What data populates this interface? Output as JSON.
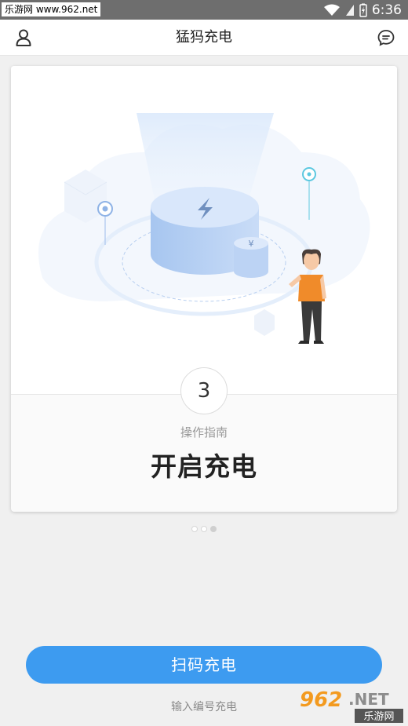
{
  "status_bar": {
    "watermark": "乐游网 www.962.net",
    "time": "6:36",
    "icons": [
      "wifi-icon",
      "cellular-signal-icon",
      "battery-charging-icon"
    ]
  },
  "header": {
    "title": "猛犸充电",
    "left_icon": "user-icon",
    "right_icon": "message-icon"
  },
  "guide": {
    "step_number": "3",
    "label": "操作指南",
    "title": "开启充电",
    "illustration": "charging-station-illustration",
    "pagination": {
      "total": 3,
      "current": 3
    }
  },
  "actions": {
    "scan_button": "扫码充电",
    "code_link": "输入编号充电"
  },
  "watermark_bottom": {
    "logo_text": "962.NET",
    "logo_subtext": "乐游网"
  },
  "colors": {
    "accent": "#3d9bf0",
    "background": "#f0f0f0",
    "status_bar": "#6e6e6e"
  }
}
